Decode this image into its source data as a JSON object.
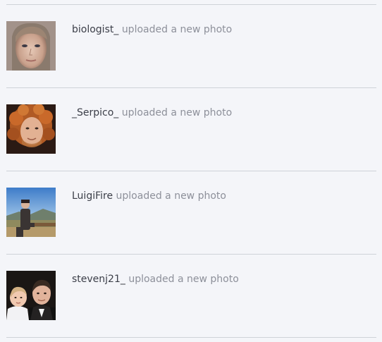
{
  "feed": {
    "items": [
      {
        "username": "biologist_",
        "action": "uploaded a new photo",
        "avatar_icon": "user-photo-woman-portrait"
      },
      {
        "username": "_Serpico_",
        "action": "uploaded a new photo",
        "avatar_icon": "user-photo-curly-hair-man"
      },
      {
        "username": "LuigiFire",
        "action": "uploaded a new photo",
        "avatar_icon": "user-photo-man-outdoors"
      },
      {
        "username": "stevenj21_",
        "action": "uploaded a new photo",
        "avatar_icon": "user-photo-family"
      }
    ]
  },
  "colors": {
    "background": "#f4f5f9",
    "divider": "#cfd2d8",
    "username": "#3b3e48",
    "action": "#8d909a"
  }
}
